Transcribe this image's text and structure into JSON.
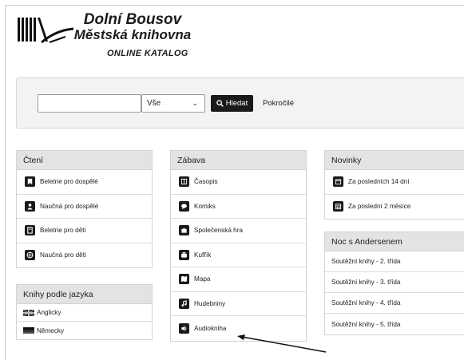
{
  "header": {
    "library_line1": "Dolní Bousov",
    "library_line2": "Městská knihovna",
    "catalog": "ONLINE KATALOG"
  },
  "search": {
    "query_value": "",
    "scope_selected": "Vše",
    "search_button": "Hledat",
    "advanced_link": "Pokročilé"
  },
  "panels": {
    "cteni": {
      "title": "Čtení",
      "items": [
        {
          "label": "Beletrie pro dospělé",
          "icon": "book-icon"
        },
        {
          "label": "Naučná pro dospělé",
          "icon": "person-icon"
        },
        {
          "label": "Beletrie pro děti",
          "icon": "book-outline-icon"
        },
        {
          "label": "Naučná pro děti",
          "icon": "globe-icon"
        }
      ]
    },
    "jazyk": {
      "title": "Knihy podle jazyka",
      "items": [
        {
          "label": "Anglicky",
          "icon": "uk-flag-icon"
        },
        {
          "label": "Německy",
          "icon": "de-flag-icon"
        }
      ]
    },
    "zabava": {
      "title": "Zábava",
      "items": [
        {
          "label": "Časopis",
          "icon": "magazine-icon"
        },
        {
          "label": "Komiks",
          "icon": "speech-bubble-icon"
        },
        {
          "label": "Společenská hra",
          "icon": "puzzle-icon"
        },
        {
          "label": "Kufřík",
          "icon": "briefcase-icon"
        },
        {
          "label": "Mapa",
          "icon": "map-icon"
        },
        {
          "label": "Hudebniny",
          "icon": "music-icon"
        },
        {
          "label": "Audiokniha",
          "icon": "speaker-icon"
        }
      ]
    },
    "novinky": {
      "title": "Novinky",
      "items": [
        {
          "label": "Za posledních 14 dní",
          "icon": "calendar-icon"
        },
        {
          "label": "Za poslední 2 měsíce",
          "icon": "calendar-grid-icon"
        }
      ]
    },
    "noc": {
      "title": "Noc s Andersenem",
      "items": [
        {
          "label": "Soutěžní knihy - 2. třída"
        },
        {
          "label": "Soutěžní knihy - 3. třída"
        },
        {
          "label": "Soutěžní knihy - 4. třída"
        },
        {
          "label": "Soutěžní knihy - 5. třída"
        }
      ]
    }
  },
  "colors": {
    "panel_header": "#e3e3e3",
    "search_button": "#1a1a1a",
    "searchbar_bg": "#f3f3f3"
  }
}
